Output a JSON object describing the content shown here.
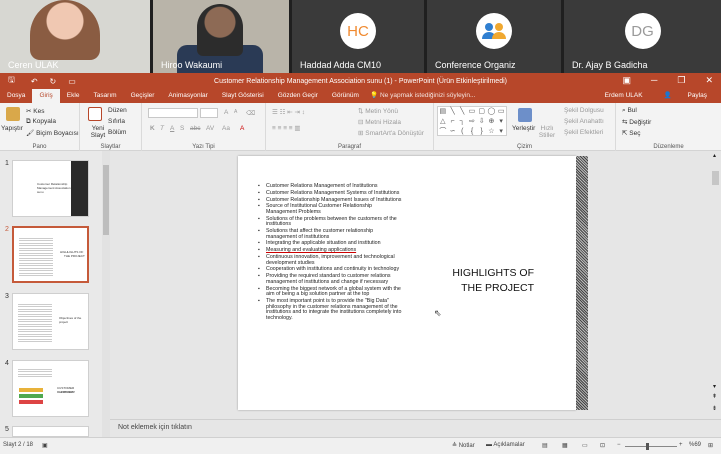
{
  "meeting": {
    "participants": [
      {
        "name": "Ceren ULAK",
        "initials": ""
      },
      {
        "name": "Hiroo Wakaumi",
        "initials": ""
      },
      {
        "name": "Haddad Adda CM10",
        "initials": "HC"
      },
      {
        "name": "Conference Organiz",
        "initials": ""
      },
      {
        "name": "Dr. Ajay B Gadicha",
        "initials": "DG"
      }
    ]
  },
  "window": {
    "title": "Customer Relationship Management Association sunu  (1) - PowerPoint (Ürün Etkinleştirilmedi)",
    "user": "Erdem ULAK",
    "share": "Paylaş"
  },
  "tabs": [
    "Dosya",
    "Giriş",
    "Ekle",
    "Tasarım",
    "Geçişler",
    "Animasyonlar",
    "Slayt Gösterisi",
    "Gözden Geçir",
    "Görünüm"
  ],
  "search_placeholder": "Ne yapmak istediğinizi söyleyin...",
  "ribbon": {
    "clipboard": {
      "paste": "Yapıştır",
      "cut": "Kes",
      "copy": "Kopyala",
      "format_painter": "Biçim Boyacısı",
      "label": "Pano"
    },
    "slides": {
      "new_slide": "Yeni Slayt",
      "layout": "Düzen",
      "reset": "Sıfırla",
      "section": "Bölüm",
      "label": "Slaytlar"
    },
    "font": {
      "label": "Yazı Tipi",
      "bold": "K",
      "italic": "T",
      "underline": "A",
      "shadow": "S",
      "strike": "abc",
      "spacing": "AV",
      "case": "Aa",
      "grow": "A",
      "shrink": "A"
    },
    "paragraph": {
      "label": "Paragraf",
      "text_direction": "Metin Yönü",
      "align_text": "Metni Hizala",
      "smartart": "SmartArt'a Dönüştür"
    },
    "drawing": {
      "label": "Çizim",
      "arrange": "Yerleştir",
      "quick_styles": "Hızlı Stiller",
      "fill": "Şekil Dolgusu",
      "outline": "Şekil Anahattı",
      "effects": "Şekil Efektleri"
    },
    "editing": {
      "label": "Düzenleme",
      "find": "Bul",
      "replace": "Değiştir",
      "select": "Seç"
    }
  },
  "thumbnails": [
    {
      "num": "1",
      "lines": [
        "Customer Relationship",
        "Management Association",
        "sunu"
      ]
    },
    {
      "num": "2",
      "lines": [
        "HIGHLIGHTS OF",
        "THE PROJECT"
      ]
    },
    {
      "num": "3",
      "lines": [
        "Objectives of the",
        "project"
      ]
    },
    {
      "num": "4",
      "lines": [
        "CUSTOMER RELATIONS",
        "PROJECT"
      ]
    },
    {
      "num": "5",
      "lines": []
    }
  ],
  "slide": {
    "title_line1": "HIGHLIGHTS OF",
    "title_line2": "THE PROJECT",
    "bullets": [
      "Customer Relations Management of Institutions",
      "Customer Relations Management Systems of Institutions",
      "Customer Relationship Management Issues of Institutions",
      "Source of Institutional Customer Relationship Management Problems",
      "Solutions of the problems between the customers of the institutions",
      "Solutions that affect the customer relationship management of institutions",
      "Integrating the applicable situation and institution",
      "Measuring and evaluating applications",
      "Continuous innovation, improvement and technological development studies",
      "Cooperation with institutions and continuity in technology",
      "Providing the required standard to customer relations management of institutions and change if necessary",
      "Becoming the biggest network of a global system with the aim of being a big solution partner at the top",
      "The most important point is to provide the \"Big Data\" philosophy in the customer relations management of the institutions and to integrate the institutions completely into technology."
    ]
  },
  "notes_placeholder": "Not eklemek için tıklatın",
  "status": {
    "slide_count": "Slayt 2 / 18",
    "notes": "Notlar",
    "comments": "Açıklamalar",
    "zoom": "%69"
  }
}
